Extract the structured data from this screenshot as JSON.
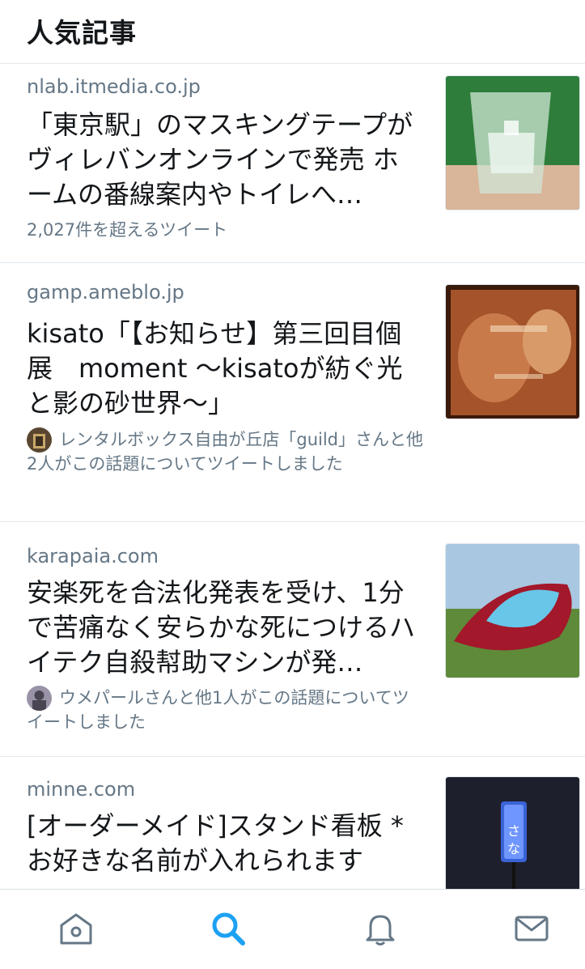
{
  "header": {
    "title": "人気記事"
  },
  "articles": [
    {
      "domain": "nlab.itmedia.co.jp",
      "title": "「東京駅」のマスキングテープがヴィレバンオンラインで発売 ホームの番線案内やトイレへ…",
      "meta": "2,027件を超えるツイート",
      "thumb_icon": "glass-photo"
    },
    {
      "domain": "gamp.ameblo.jp",
      "title": "kisato「【お知らせ】第三回目個展　moment 〜kisatoが紡ぐ光と影の砂世界〜」",
      "tweeted": "レンタルボックス自由が丘店「guild」さんと他2人がこの話題についてツイートしました",
      "thumb_icon": "sand-art-photo",
      "avatar_icon": "shop-avatar"
    },
    {
      "domain": "karapaia.com",
      "title": "安楽死を合法化発表を受け、1分で苦痛なく安らかな死につけるハイテク自殺幇助マシンが発…",
      "tweeted": "ウメパールさんと他1人がこの話題についてツイートしました",
      "thumb_icon": "capsule-photo",
      "avatar_icon": "user-avatar"
    },
    {
      "domain": "minne.com",
      "title": "[オーダーメイド]スタンド看板 * お好きな名前が入れられます",
      "thumb_icon": "signboard-photo"
    }
  ],
  "tabbar": {
    "items": [
      "home-icon",
      "search-icon",
      "notifications-icon",
      "messages-icon"
    ],
    "active": "search-icon",
    "active_color": "#1da1f2",
    "inactive_color": "#657786"
  }
}
